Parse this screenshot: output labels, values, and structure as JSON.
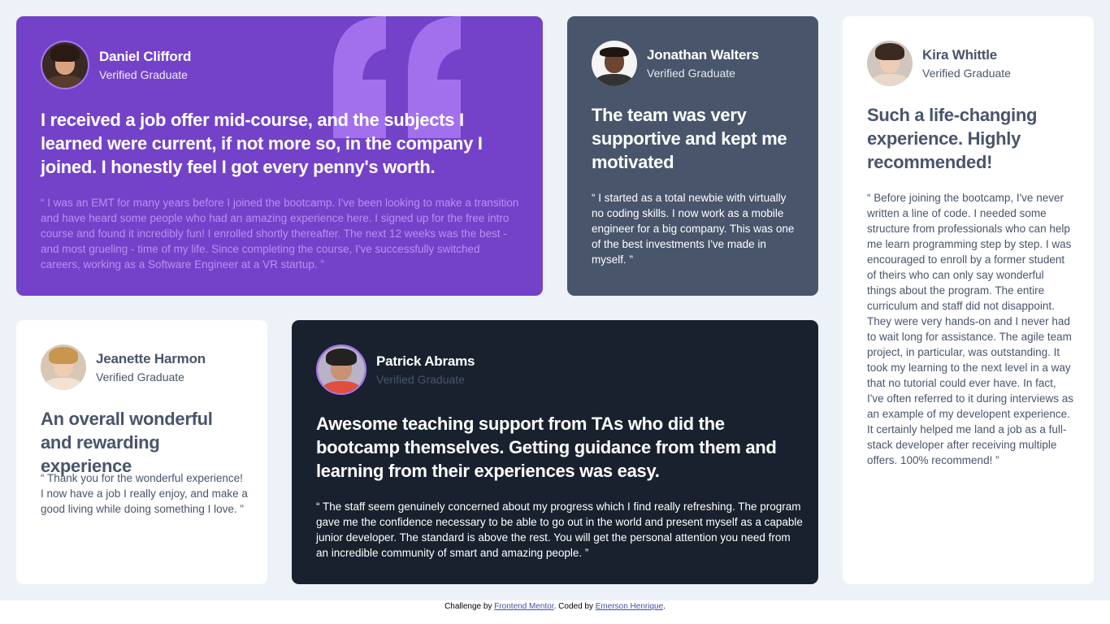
{
  "testimonials": [
    {
      "name": "Daniel Clifford",
      "role": "Verified Graduate",
      "summary": "I received a job offer mid-course, and the subjects I learned were current, if not more so, in the company I joined. I honestly feel I got every penny's worth.",
      "body": "“ I was an EMT for many years before I joined the bootcamp. I've been looking to make a transition and have heard some people who had an amazing experience here. I signed up for the free intro course and found it incredibly fun! I enrolled shortly thereafter. The next 12 weeks was the best - and most grueling - time of my life. Since completing the course, I've successfully switched careers, working as a Software Engineer at a VR startup. ”"
    },
    {
      "name": "Jonathan Walters",
      "role": "Verified Graduate",
      "summary": "The team was very supportive and kept me motivated",
      "body": "“ I started as a total newbie with virtually no coding skills. I now work as a mobile engineer for a big company. This was one of the best investments I've made in myself. ”"
    },
    {
      "name": "Kira Whittle",
      "role": "Verified Graduate",
      "summary": "Such a life-changing experience. Highly recommended!",
      "body": "“ Before joining the bootcamp, I've never written a line of code. I needed some structure from professionals who can help me learn programming step by step. I was encouraged to enroll by a former student of theirs who can only say wonderful things about the program. The entire curriculum and staff did not disappoint. They were very hands-on and I never had to wait long for assistance. The agile team project, in particular, was outstanding. It took my learning to the next level in a way that no tutorial could ever have. In fact, I've often referred to it during interviews as an example of my developent experience. It certainly helped me land a job as a full-stack developer after receiving multiple offers. 100% recommend! ”"
    },
    {
      "name": "Jeanette Harmon",
      "role": "Verified Graduate",
      "summary": "An overall wonderful and rewarding experience",
      "body": "“ Thank you for the wonderful experience! I now have a job I really enjoy, and make a good living while doing something I love. ”"
    },
    {
      "name": "Patrick Abrams",
      "role": "Verified Graduate",
      "summary": "Awesome teaching support from TAs who did the bootcamp themselves. Getting guidance from them and learning from their experiences was easy.",
      "body": "“ The staff seem genuinely concerned about my progress which I find really refreshing. The program gave me the confidence necessary to be able to go out in the world and present myself as a capable junior developer. The standard is above the rest. You will get the personal attention you need from an incredible community of smart and amazing people. ”"
    }
  ],
  "footer": {
    "prefix": "Challenge by ",
    "link1": "Frontend Mentor",
    "middle": ". Coded by ",
    "link2": "Emerson Henrique",
    "suffix": "."
  },
  "colors": {
    "page_bg": "#edf1f8",
    "purple_card": "#7442c9",
    "gray_card": "#48556b",
    "dark_card": "#19212e",
    "white_card": "#ffffff",
    "accent_ring": "#a775f1"
  }
}
